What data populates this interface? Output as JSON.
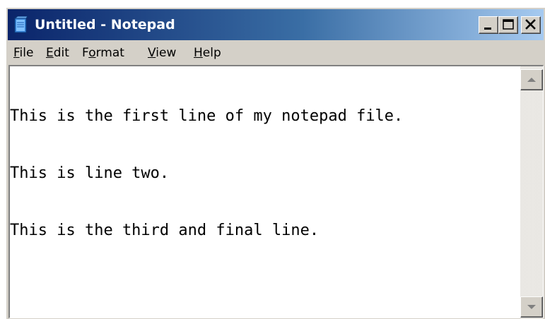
{
  "window": {
    "title": "Untitled - Notepad",
    "app_icon": "notepad-icon",
    "controls": {
      "minimize_icon": "minimize-icon",
      "maximize_icon": "maximize-icon",
      "close_icon": "close-icon"
    }
  },
  "menubar": {
    "items": [
      {
        "mnemonic": "F",
        "rest": "ile"
      },
      {
        "mnemonic": "E",
        "rest": "dit"
      },
      {
        "before": "F",
        "mnemonic": "o",
        "rest": "rmat"
      },
      {
        "mnemonic": "V",
        "rest": "iew"
      },
      {
        "mnemonic": "H",
        "rest": "elp"
      }
    ]
  },
  "editor": {
    "lines": [
      "This is the first line of my notepad file.",
      "This is line two.",
      "This is the third and final line."
    ]
  },
  "scrollbar": {
    "up_icon": "scroll-up-arrow-icon",
    "down_icon": "scroll-down-arrow-icon"
  },
  "colors": {
    "titlebar_start": "#0a246a",
    "titlebar_end": "#a6caf0",
    "window_face": "#d4d0c8",
    "editor_bg": "#ffffff"
  }
}
